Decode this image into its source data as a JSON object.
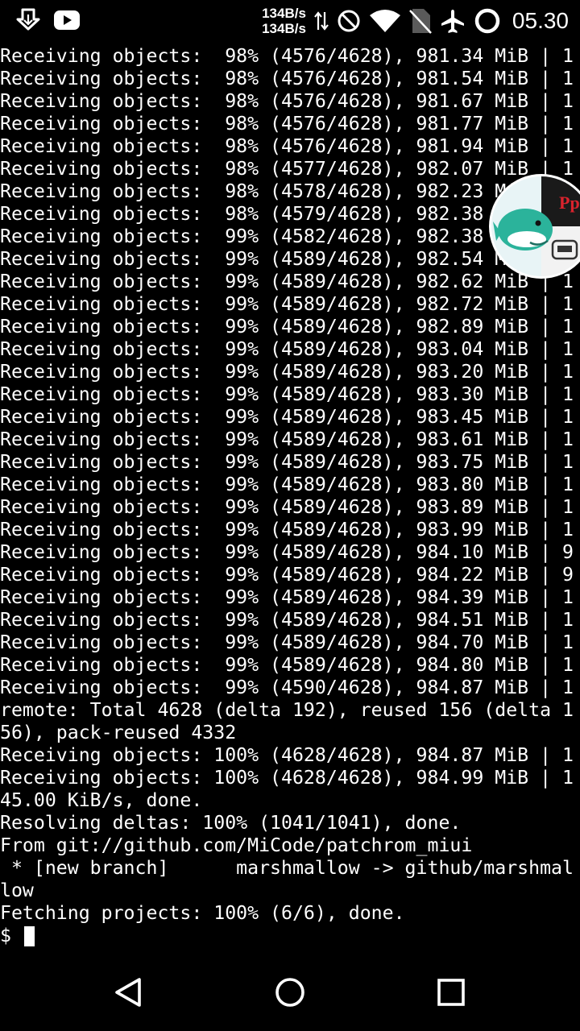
{
  "status_bar": {
    "speed_up": "134B/s",
    "speed_down": "134B/s",
    "time": "05.30",
    "icons": [
      "download-icon",
      "youtube-icon",
      "data-transfer-icon",
      "do-not-disturb-icon",
      "wifi-icon",
      "no-sim-icon",
      "airplane-mode-icon",
      "battery-ring-icon"
    ]
  },
  "terminal": {
    "lines": [
      "Receiving objects:  98% (4576/4628), 981.34 MiB | 1",
      "Receiving objects:  98% (4576/4628), 981.54 MiB | 1",
      "Receiving objects:  98% (4576/4628), 981.67 MiB | 1",
      "Receiving objects:  98% (4576/4628), 981.77 MiB | 1",
      "Receiving objects:  98% (4576/4628), 981.94 MiB | 1",
      "Receiving objects:  98% (4577/4628), 982.07 MiB | 1",
      "Receiving objects:  98% (4578/4628), 982.23 MiB | 1",
      "Receiving objects:  98% (4579/4628), 982.38 MiB | 1",
      "Receiving objects:  99% (4582/4628), 982.38 MiB | 1",
      "Receiving objects:  99% (4589/4628), 982.54 MiB | 1",
      "Receiving objects:  99% (4589/4628), 982.62 MiB | 1",
      "Receiving objects:  99% (4589/4628), 982.72 MiB | 1",
      "Receiving objects:  99% (4589/4628), 982.89 MiB | 1",
      "Receiving objects:  99% (4589/4628), 983.04 MiB | 1",
      "Receiving objects:  99% (4589/4628), 983.20 MiB | 1",
      "Receiving objects:  99% (4589/4628), 983.30 MiB | 1",
      "Receiving objects:  99% (4589/4628), 983.45 MiB | 1",
      "Receiving objects:  99% (4589/4628), 983.61 MiB | 1",
      "Receiving objects:  99% (4589/4628), 983.75 MiB | 1",
      "Receiving objects:  99% (4589/4628), 983.80 MiB | 1",
      "Receiving objects:  99% (4589/4628), 983.89 MiB | 1",
      "Receiving objects:  99% (4589/4628), 983.99 MiB | 1",
      "Receiving objects:  99% (4589/4628), 984.10 MiB | 9",
      "Receiving objects:  99% (4589/4628), 984.22 MiB | 9",
      "Receiving objects:  99% (4589/4628), 984.39 MiB | 1",
      "Receiving objects:  99% (4589/4628), 984.51 MiB | 1",
      "Receiving objects:  99% (4589/4628), 984.70 MiB | 1",
      "Receiving objects:  99% (4589/4628), 984.80 MiB | 1",
      "Receiving objects:  99% (4590/4628), 984.87 MiB | 1",
      "remote: Total 4628 (delta 192), reused 156 (delta 1",
      "56), pack-reused 4332",
      "Receiving objects: 100% (4628/4628), 984.87 MiB | 1",
      "Receiving objects: 100% (4628/4628), 984.99 MiB | 1",
      "45.00 KiB/s, done.",
      "Resolving deltas: 100% (1041/1041), done.",
      "From git://github.com/MiCode/patchrom_miui",
      " * [new branch]      marshmallow -> github/marshmal",
      "low",
      "Fetching projects: 100% (6/6), done."
    ],
    "prompt": "$ "
  },
  "floating_bubble": {
    "icon": "floating-app-bubble-icon",
    "label": "Pp"
  },
  "nav_bar": {
    "buttons": [
      "back-icon",
      "home-icon",
      "recents-icon"
    ]
  },
  "colors": {
    "background": "#000000",
    "text": "#ffffff",
    "bubble_teal": "#2bb39b",
    "bubble_red": "#d9232d"
  }
}
